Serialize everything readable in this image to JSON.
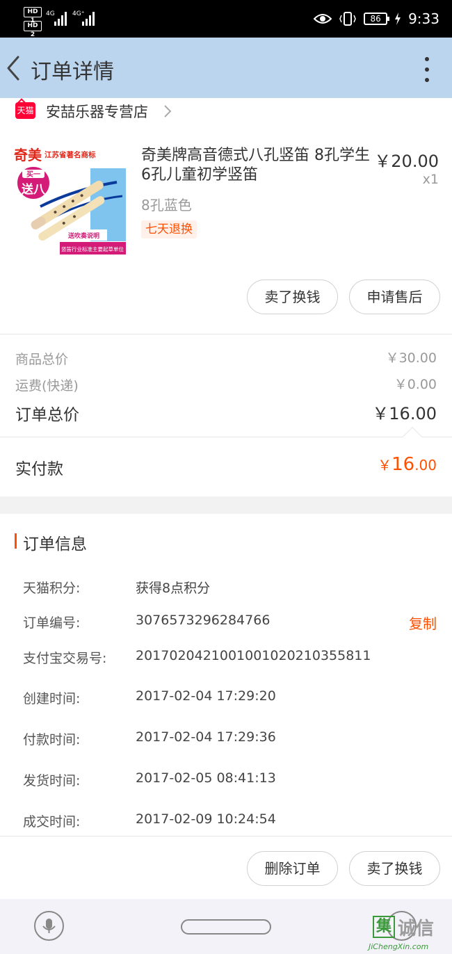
{
  "status_bar": {
    "hd1": "HD 1",
    "hd2": "HD 2",
    "net1": "4G",
    "net2": "4G⁺",
    "battery": "86",
    "time": "9:33"
  },
  "header": {
    "title": "订单详情",
    "back_icon": "chevron-left-icon",
    "more_icon": "more-vertical-icon"
  },
  "store": {
    "badge": "天猫",
    "name": "安喆乐器专营店"
  },
  "product": {
    "title": "奇美牌高音德式八孔竖笛 8孔学生6孔儿童初学竖笛",
    "price": "￥20.00",
    "quantity": "x1",
    "sku": "8孔蓝色",
    "service_tag": "七天退换",
    "image": {
      "brand": "奇美",
      "brand_note": "江苏省著名商标",
      "promo_top": "买一",
      "promo_bottom": "送八",
      "gift_text": "送吹奏说明",
      "footer_text": "竖笛行业标准主要起草单位"
    }
  },
  "product_actions": {
    "sell": "卖了换钱",
    "after_sale": "申请售后"
  },
  "prices": {
    "goods_label": "商品总价",
    "goods_value": "￥30.00",
    "shipping_label": "运费(快递)",
    "shipping_value": "￥0.00",
    "total_label": "订单总价",
    "total_value": "￥16.00",
    "paid_label": "实付款",
    "paid_currency": "￥",
    "paid_int": "16",
    "paid_dec": ".00"
  },
  "order_info": {
    "title": "订单信息",
    "rows": [
      {
        "label": "天猫积分:",
        "value": "获得8点积分"
      },
      {
        "label": "订单编号:",
        "value": "3076573296284766"
      },
      {
        "label": "支付宝交易号:",
        "value": "2017020421001001020210355811"
      },
      {
        "label": "创建时间:",
        "value": "2017-02-04 17:29:20"
      },
      {
        "label": "付款时间:",
        "value": "2017-02-04 17:29:36"
      },
      {
        "label": "发货时间:",
        "value": "2017-02-05 08:41:13"
      },
      {
        "label": "成交时间:",
        "value": "2017-02-09 10:24:54"
      }
    ],
    "copy": "复制"
  },
  "bottom_actions": {
    "delete": "删除订单",
    "sell": "卖了换钱"
  },
  "nav_bar": {
    "mic_icon": "microphone-icon",
    "home_icon": "home-pill-icon",
    "assist_icon": "assistant-icon"
  },
  "watermark": {
    "box": "集",
    "text": "诚信",
    "sub": "JiChengXin.com"
  },
  "colors": {
    "accent": "#ff5000",
    "header_bg": "#bcd5ef",
    "tmall_red": "#ff0036"
  }
}
